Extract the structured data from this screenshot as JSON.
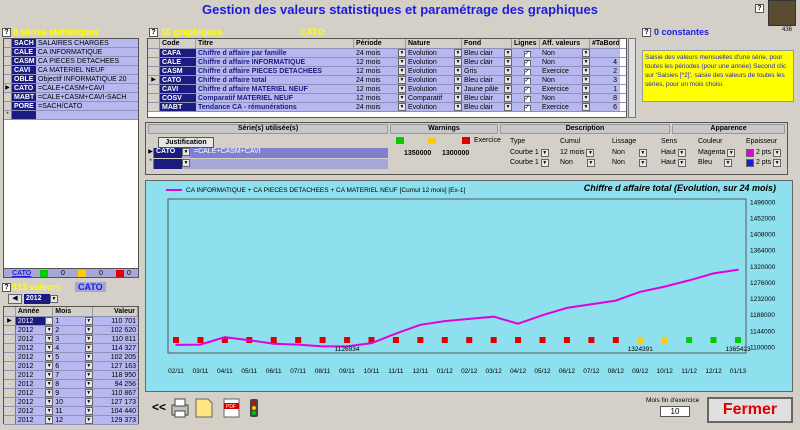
{
  "window": {
    "title": "Gestion des valeurs statistiques et paramétrage des graphiques",
    "help_label": "?",
    "small_num": "436"
  },
  "series_panel": {
    "header": "8 séries statistiques",
    "items": [
      {
        "code": "SACH",
        "label": "SALAIRES CHARGES"
      },
      {
        "code": "CALE",
        "label": "CA INFORMATIQUE"
      },
      {
        "code": "CASM",
        "label": "CA PIECES DETACHEES"
      },
      {
        "code": "CAVI",
        "label": "CA MATERIEL NEUF"
      },
      {
        "code": "OBLE",
        "label": "Objectif INFORMATIQUE 20"
      },
      {
        "code": "CATO",
        "label": "=CALE+CASM+CAVI"
      },
      {
        "code": "MABT",
        "label": "=CALE+CASM+CAVI-SACH"
      },
      {
        "code": "PORE",
        "label": "=SACH/CATO"
      }
    ],
    "footer_code": "CATO",
    "footer_vals": [
      "0",
      "0",
      "0"
    ]
  },
  "graphs_panel": {
    "header": "10 graphiques",
    "current_code": "CATO",
    "columns": [
      "Code",
      "Titre",
      "Période",
      "Nature",
      "Fond",
      "Lignes",
      "Aff. valeurs",
      "#TaBord"
    ],
    "rows": [
      {
        "code": "CAFA",
        "titre": "Chiffre d affaire par famille",
        "periode": "24 mois",
        "nature": "Evolution",
        "fond": "Bleu clair",
        "aff": "Non",
        "tabord": ""
      },
      {
        "code": "CALE",
        "titre": "Chiffre d affaire INFORMATIQUE",
        "periode": "12 mois",
        "nature": "Evolution",
        "fond": "Bleu clair",
        "aff": "Non",
        "tabord": "4"
      },
      {
        "code": "CASM",
        "titre": "Chiffre d affaire PIECES DETACHEES",
        "periode": "12 mois",
        "nature": "Evolution",
        "fond": "Gris",
        "aff": "Exercice",
        "tabord": "2"
      },
      {
        "code": "CATO",
        "titre": "Chiffre d affaire total",
        "periode": "24 mois",
        "nature": "Evolution",
        "fond": "Bleu clair",
        "aff": "Non",
        "tabord": "3"
      },
      {
        "code": "CAVI",
        "titre": "Chiffre d affaire MATERIEL NEUF",
        "periode": "12 mois",
        "nature": "Evolution",
        "fond": "Jaune pâle",
        "aff": "Exercice",
        "tabord": "1"
      },
      {
        "code": "COSV",
        "titre": "Comparatif MATERIEL NEUF",
        "periode": "12 mois",
        "nature": "Comparatif",
        "fond": "Bleu clair",
        "aff": "Non",
        "tabord": "8"
      },
      {
        "code": "MABT",
        "titre": "Tendance CA - rémunérations",
        "periode": "24 mois",
        "nature": "Evolution",
        "fond": "Bleu clair",
        "aff": "Exercice",
        "tabord": "6"
      }
    ]
  },
  "constants_panel": {
    "header": "0 constantes"
  },
  "help_note": "Saisie des valeurs mensuelles d'une série, pour toutes les périodes (pour une année) Second clic sur 'Saisies [*2]', saisie des valeurs de toutes les séries, pour un mois choisi.",
  "series_used": {
    "title": "Série(s) utilisée(s)",
    "justification_label": "Justification",
    "warnings_label": "Warnings",
    "exercice_label": "Exercice",
    "description_label": "Description",
    "apparence_label": "Apparence",
    "columns": [
      "Type",
      "Cumul",
      "Lissage",
      "Sens",
      "Couleur",
      "Epaisseur"
    ],
    "row": {
      "code": "CATO",
      "formula": "=CALE+CASM+CAVI",
      "w1": "1350000",
      "w2": "1300000",
      "type_a": "Courbe 1",
      "type_b": "Courbe 1",
      "cumul_a": "12 mois",
      "cumul_b": "Non",
      "lissage_a": "Non",
      "lissage_b": "Non",
      "sens_a": "Haut",
      "sens_b": "Haut",
      "couleur_a": "Magenta",
      "couleur_b": "Bleu",
      "ep_a": "2 pts",
      "ep_b": "2 pts"
    }
  },
  "values_panel": {
    "header": "313 valeurs",
    "code": "CATO",
    "year": "2012",
    "columns": [
      "Année",
      "Mois",
      "Valeur"
    ],
    "rows": [
      {
        "annee": "2012",
        "mois": "1",
        "valeur": "110 701"
      },
      {
        "annee": "2012",
        "mois": "2",
        "valeur": "102 620"
      },
      {
        "annee": "2012",
        "mois": "3",
        "valeur": "110 811"
      },
      {
        "annee": "2012",
        "mois": "4",
        "valeur": "114 327"
      },
      {
        "annee": "2012",
        "mois": "5",
        "valeur": "102 205"
      },
      {
        "annee": "2012",
        "mois": "6",
        "valeur": "127 163"
      },
      {
        "annee": "2012",
        "mois": "7",
        "valeur": "118 950"
      },
      {
        "annee": "2012",
        "mois": "8",
        "valeur": "94 256"
      },
      {
        "annee": "2012",
        "mois": "9",
        "valeur": "110 867"
      },
      {
        "annee": "2012",
        "mois": "10",
        "valeur": "127 173"
      },
      {
        "annee": "2012",
        "mois": "11",
        "valeur": "104 440"
      },
      {
        "annee": "2012",
        "mois": "12",
        "valeur": "129 373"
      }
    ]
  },
  "bottom": {
    "nav_label": "<<",
    "mois_fin_label": "Mois fin d'exercice",
    "mois_fin_value": "10",
    "close_label": "Fermer"
  },
  "colors": {
    "green": "#00cc00",
    "orange": "#ffcc00",
    "red": "#e00000",
    "magenta": "#e000e0"
  },
  "chart_data": {
    "type": "line",
    "title": "Chiffre d affaire total (Evolution, sur 24 mois)",
    "legend": "CA INFORMATIQUE + CA PIECES DETACHEES + CA MATERIEL NEUF  [Cumul 12 mois] [Ex-1]",
    "x": [
      "02/11",
      "03/11",
      "04/11",
      "05/11",
      "06/11",
      "07/11",
      "08/11",
      "09/11",
      "10/11",
      "11/11",
      "12/11",
      "01/12",
      "02/12",
      "03/12",
      "04/12",
      "05/12",
      "06/12",
      "07/12",
      "08/12",
      "09/12",
      "10/12",
      "11/12",
      "12/12",
      "01/13"
    ],
    "series": [
      {
        "name": "CA INFORMATIQUE + CA PIECES DETACHEES + CA MATERIEL NEUF  [Cumul 12 mois] [Ex-1]",
        "color": "#e000e0",
        "values": [
          1107000,
          1108000,
          1128000,
          1120000,
          1110000,
          1108000,
          1103000,
          1103000,
          1112000,
          1138000,
          1162000,
          1172000,
          1178000,
          1184000,
          1165000,
          1188000,
          1208000,
          1218000,
          1228000,
          1252000,
          1266000,
          1283000,
          1302000,
          1312000
        ]
      }
    ],
    "markers": [
      "red",
      "red",
      "red",
      "red",
      "red",
      "red",
      "red",
      "red",
      "red",
      "red",
      "red",
      "red",
      "red",
      "red",
      "red",
      "red",
      "red",
      "red",
      "red",
      "orange",
      "orange",
      "green",
      "green",
      "green"
    ],
    "annotations": [
      {
        "x_index": 7,
        "text": "1126934"
      },
      {
        "x_index": 19,
        "text": "1324391"
      },
      {
        "x_index": 23,
        "text": "1365423"
      }
    ],
    "yticks": [
      1100000,
      1144000,
      1188000,
      1232000,
      1276000,
      1320000,
      1364000,
      1408000,
      1452000,
      1496000
    ],
    "ylim": [
      1085000,
      1505000
    ]
  }
}
